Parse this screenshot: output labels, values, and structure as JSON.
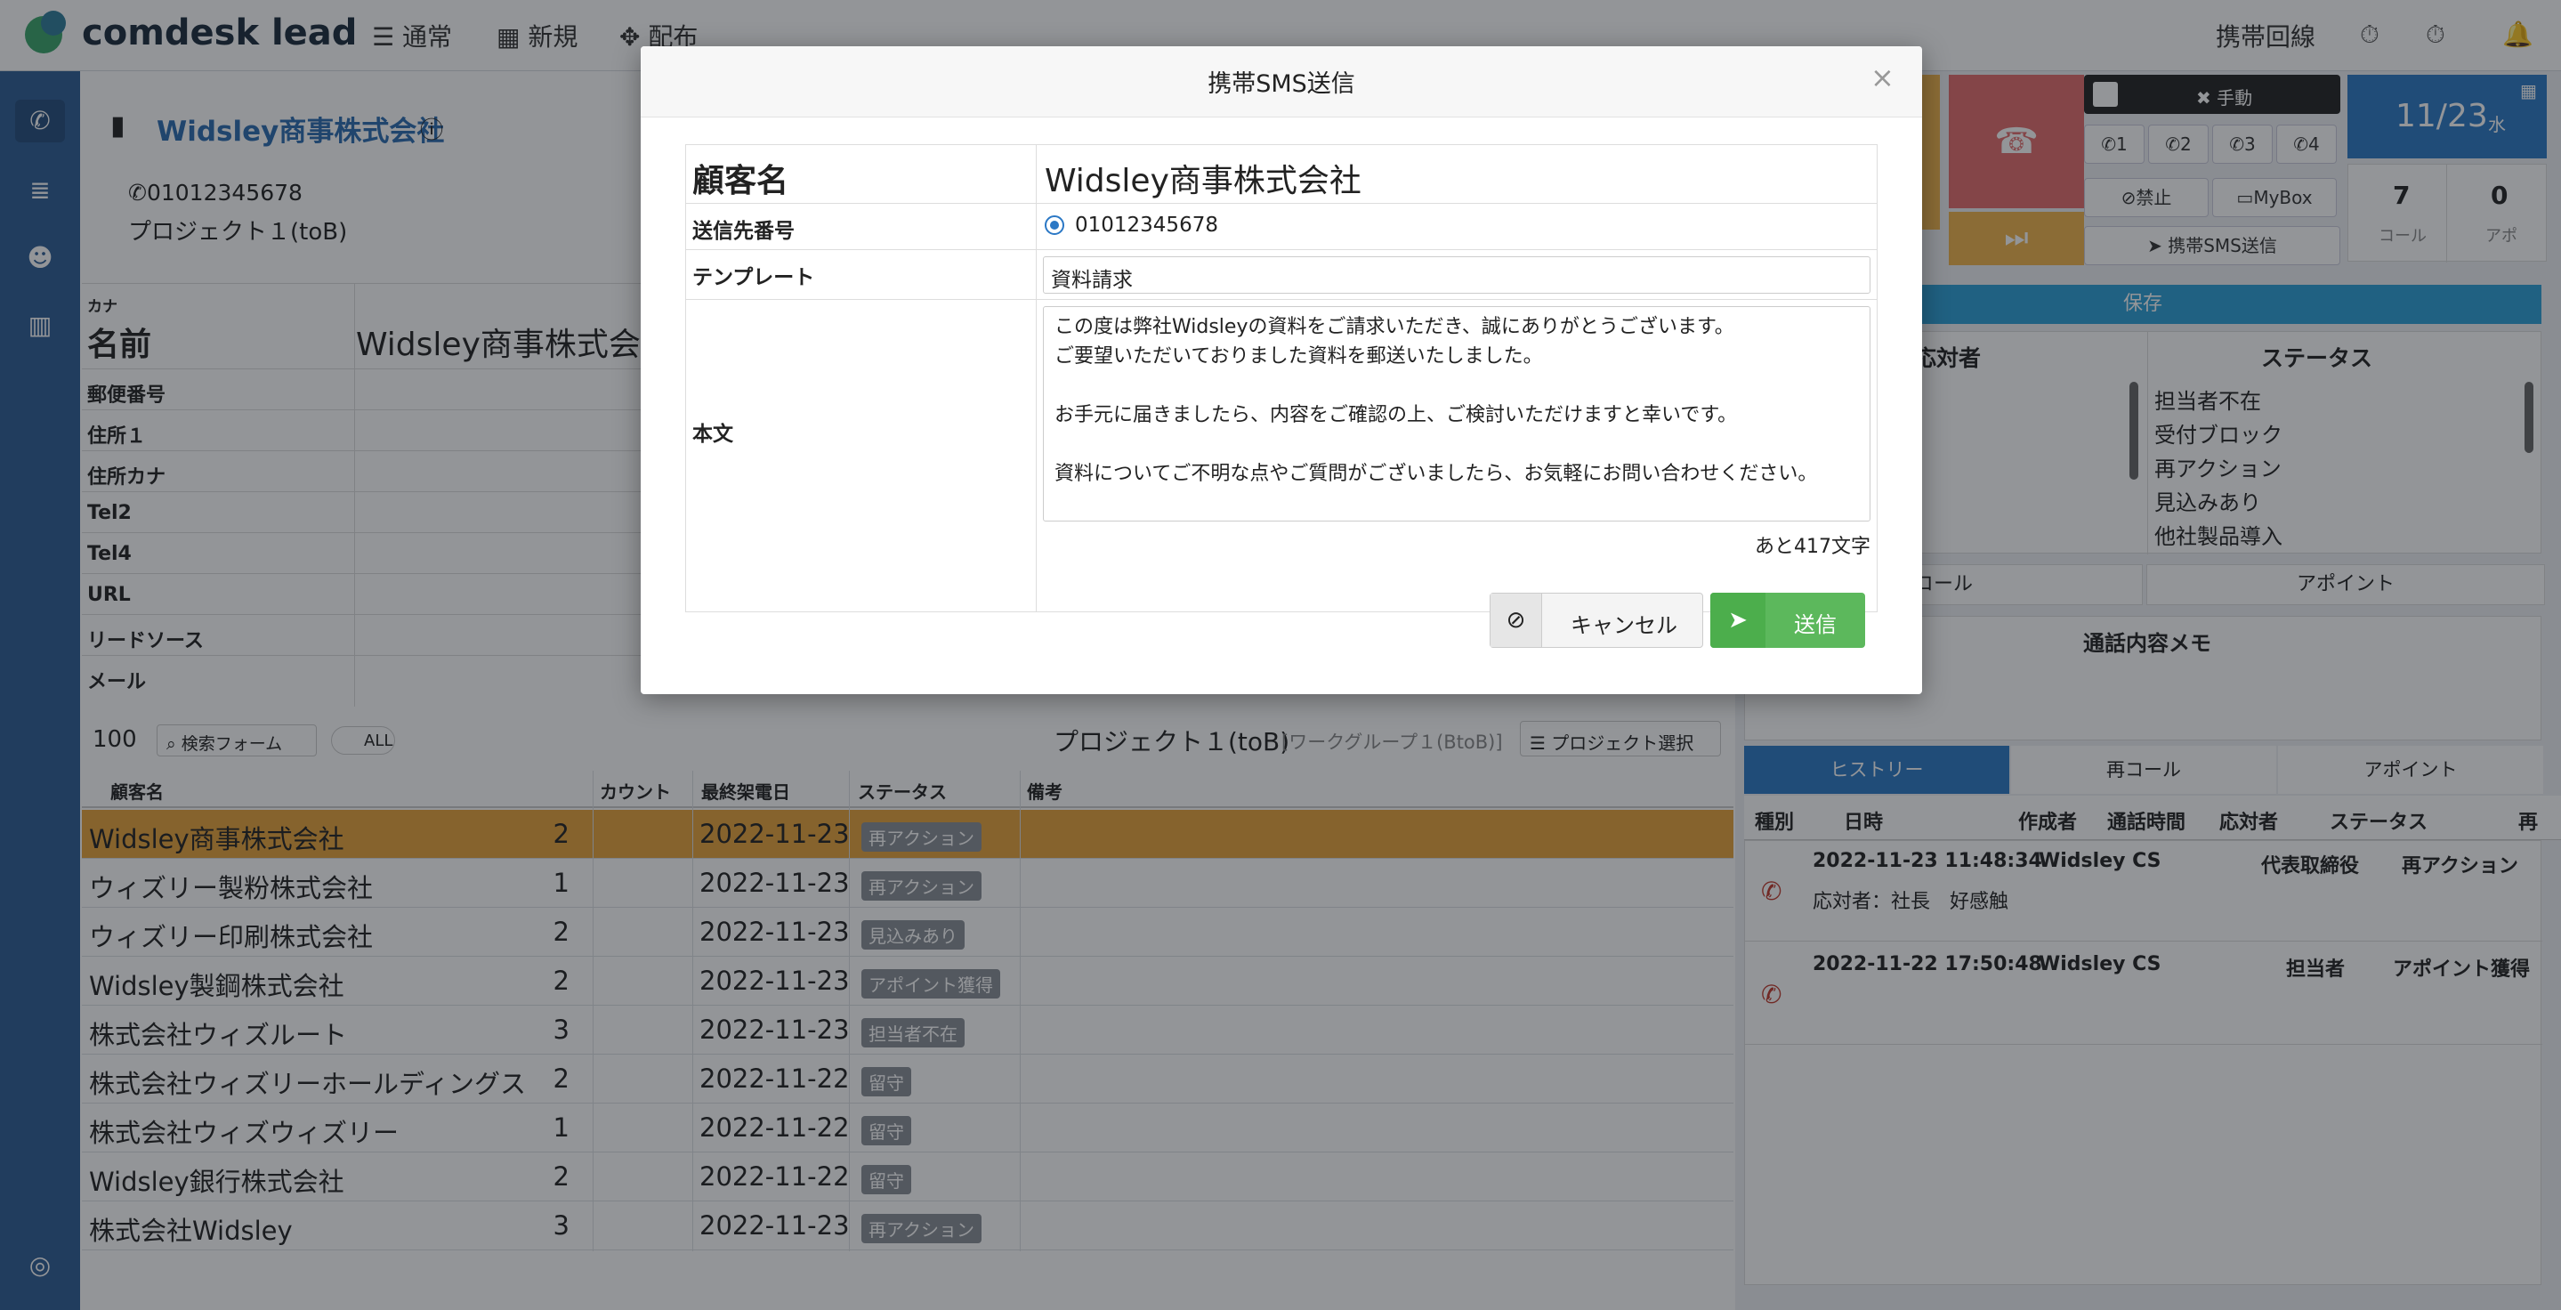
{
  "app": {
    "logo": "comdesk lead",
    "nav": [
      "通常",
      "新規",
      "配布"
    ],
    "right_label": "携帯回線"
  },
  "company": {
    "name": "Widsley商事株式会社",
    "phone": "01012345678",
    "project": "プロジェクト１(toB)"
  },
  "fields": {
    "kana": "カナ",
    "name_label": "名前",
    "name_value": "Widsley商事株式会社",
    "labels": [
      "郵便番号",
      "住所１",
      "住所カナ",
      "Tel2",
      "Tel4",
      "URL",
      "リードソース",
      "メール"
    ]
  },
  "list": {
    "count": "100",
    "search_label": "検索フォーム",
    "all_label": "ALL",
    "project_title": "プロジェクト１(toB)",
    "workgroup": "[ワークグループ１(BtoB)]",
    "project_select": "プロジェクト選択",
    "headers": [
      "顧客名",
      "カウント",
      "最終架電日",
      "ステータス",
      "備考"
    ],
    "rows": [
      {
        "name": "Widsley商事株式会社",
        "count": "2",
        "date": "2022-11-23",
        "status": "再アクション"
      },
      {
        "name": "ウィズリー製粉株式会社",
        "count": "1",
        "date": "2022-11-23",
        "status": "再アクション"
      },
      {
        "name": "ウィズリー印刷株式会社",
        "count": "2",
        "date": "2022-11-23",
        "status": "見込みあり"
      },
      {
        "name": "Widsley製鋼株式会社",
        "count": "2",
        "date": "2022-11-23",
        "status": "アポイント獲得"
      },
      {
        "name": "株式会社ウィズルート",
        "count": "3",
        "date": "2022-11-23",
        "status": "担当者不在"
      },
      {
        "name": "株式会社ウィズリーホールディングス",
        "count": "2",
        "date": "2022-11-22",
        "status": "留守"
      },
      {
        "name": "株式会社ウィズウィズリー",
        "count": "1",
        "date": "2022-11-22",
        "status": "留守"
      },
      {
        "name": "Widsley銀行株式会社",
        "count": "2",
        "date": "2022-11-22",
        "status": "留守"
      },
      {
        "name": "株式会社Widsley",
        "count": "3",
        "date": "2022-11-23",
        "status": "再アクション"
      }
    ]
  },
  "phone_panel": {
    "manual": "手動",
    "lines": [
      "1",
      "2",
      "3",
      "4"
    ],
    "ban": "禁止",
    "mybox": "MyBox",
    "sms": "携帯SMS送信",
    "date": "11/23",
    "weekday": "水",
    "calls": "7",
    "calls_label": "コール",
    "appos": "0",
    "appos_label": "アポ"
  },
  "right_panel": {
    "save": "保存",
    "responder_header": "応対者",
    "status_header": "ステータス",
    "statuses": [
      "担当者不在",
      "受付ブロック",
      "再アクション",
      "見込みあり",
      "他社製品導入"
    ],
    "recall": "コール",
    "appoint": "アポイント",
    "memo_title": "通話内容メモ",
    "tabs": [
      "ヒストリー",
      "再コール",
      "アポイント"
    ],
    "history_headers": [
      "種別",
      "日時",
      "作成者",
      "通話時間",
      "応対者",
      "ステータス",
      "再"
    ],
    "history": [
      {
        "datetime": "2022-11-23 11:48:34",
        "creator": "Widsley CS",
        "responder": "代表取締役",
        "status": "再アクション",
        "note": "応対者：社長　好感触"
      },
      {
        "datetime": "2022-11-22 17:50:48",
        "creator": "Widsley CS",
        "responder": "担当者",
        "status": "アポイント獲得",
        "note": ""
      }
    ]
  },
  "modal": {
    "title": "携帯SMS送信",
    "customer_label": "顧客名",
    "customer_value": "Widsley商事株式会社",
    "number_label": "送信先番号",
    "number_value": "01012345678",
    "template_label": "テンプレート",
    "template_value": "資料請求",
    "body_label": "本文",
    "body_lines": [
      "この度は弊社Widsleyの資料をご請求いただき、誠にありがとうございます。",
      "ご要望いただいておりました資料を郵送いたしました。",
      "",
      "お手元に届きましたら、内容をご確認の上、ご検討いただけますと幸いです。",
      "",
      "資料についてご不明な点やご質問がございましたら、お気軽にお問い合わせください。"
    ],
    "remaining": "あと417文字",
    "cancel": "キャンセル",
    "send": "送信"
  },
  "colors": {
    "brand": "#2e5d94",
    "highlight_row": "#e8a33a",
    "send": "#5cb85c",
    "accent_blue": "#2b78c5"
  }
}
